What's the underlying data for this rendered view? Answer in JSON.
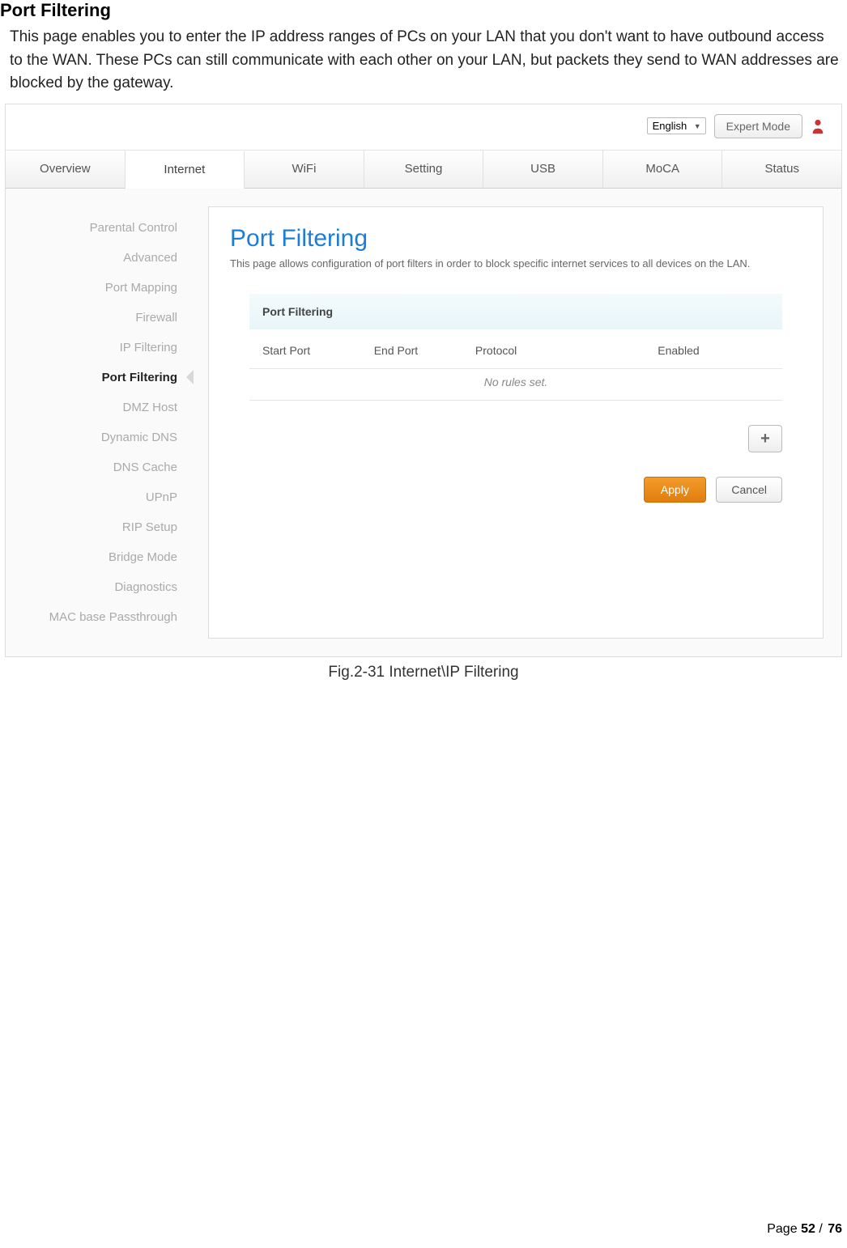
{
  "doc": {
    "section_title": "Port Filtering",
    "section_desc": "This page enables you to enter the IP address ranges of PCs on your LAN that you don't want to have outbound access to the WAN. These PCs can still communicate with each other on your LAN, but packets they send to WAN addresses are blocked by the gateway.",
    "caption": "Fig.2-31 Internet\\IP Filtering",
    "page_label": "Page",
    "page_current": "52",
    "page_total": "76"
  },
  "topbar": {
    "language_selected": "English",
    "expert_mode_label": "Expert Mode"
  },
  "tabs": [
    {
      "label": "Overview"
    },
    {
      "label": "Internet"
    },
    {
      "label": "WiFi"
    },
    {
      "label": "Setting"
    },
    {
      "label": "USB"
    },
    {
      "label": "MoCA"
    },
    {
      "label": "Status"
    }
  ],
  "sidebar": {
    "items": [
      {
        "label": "Parental Control"
      },
      {
        "label": "Advanced"
      },
      {
        "label": "Port Mapping"
      },
      {
        "label": "Firewall"
      },
      {
        "label": "IP Filtering"
      },
      {
        "label": "Port Filtering"
      },
      {
        "label": "DMZ Host"
      },
      {
        "label": "Dynamic DNS"
      },
      {
        "label": "DNS Cache"
      },
      {
        "label": "UPnP"
      },
      {
        "label": "RIP Setup"
      },
      {
        "label": "Bridge Mode"
      },
      {
        "label": "Diagnostics"
      },
      {
        "label": "MAC base Passthrough"
      }
    ],
    "active_index": 5
  },
  "content": {
    "page_title": "Port Filtering",
    "page_intro": "This page allows configuration of port filters in order to block specific internet services to all devices on the LAN.",
    "panel_title": "Port Filtering",
    "columns": {
      "start": "Start Port",
      "end": "End Port",
      "protocol": "Protocol",
      "enabled": "Enabled"
    },
    "empty_message": "No rules set.",
    "add_label": "+",
    "apply_label": "Apply",
    "cancel_label": "Cancel"
  }
}
